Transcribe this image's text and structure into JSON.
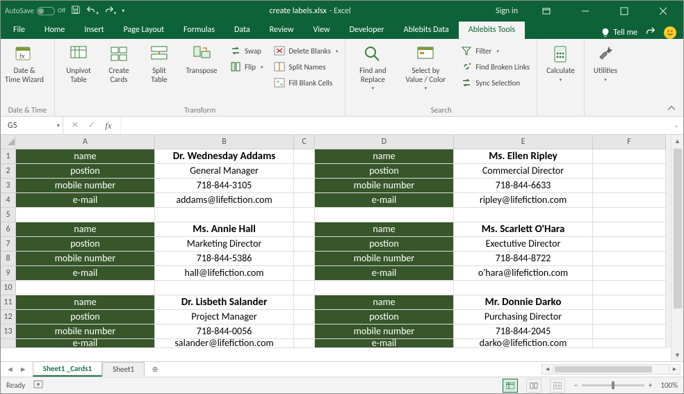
{
  "title": {
    "autosave": "AutoSave",
    "autosave_state": "Off",
    "filename": "create labels.xlsx",
    "app": " - Excel",
    "signin": "Sign in"
  },
  "file_tab": "File",
  "tabs": [
    "Home",
    "Insert",
    "Page Layout",
    "Formulas",
    "Data",
    "Review",
    "View",
    "Developer",
    "Ablebits Data",
    "Ablebits Tools"
  ],
  "active_tab": "Ablebits Tools",
  "tellme": "Tell me",
  "ribbon": {
    "groups": {
      "datetime": {
        "label": "Date & Time",
        "btn": "Date &\nTime Wizard"
      },
      "transform": {
        "label": "Transform",
        "big": [
          "Unpivot\nTable",
          "Create\nCards",
          "Split\nTable",
          "Transpose"
        ],
        "small": [
          "Swap",
          "Flip",
          "Delete Blanks",
          "Split Names",
          "Fill Blank Cells"
        ]
      },
      "search": {
        "label": "Search",
        "big": [
          "Find and\nReplace",
          "Select by\nValue / Color"
        ],
        "small": [
          "Filter",
          "Find Broken Links",
          "Sync Selection"
        ]
      },
      "calc": {
        "btn": "Calculate"
      },
      "util": {
        "btn": "Utilities"
      }
    }
  },
  "namebox": "G5",
  "formula": "",
  "columns": [
    "A",
    "B",
    "C",
    "D",
    "E",
    "F"
  ],
  "rows": [
    "1",
    "2",
    "3",
    "4",
    "5",
    "6",
    "7",
    "8",
    "9",
    "10",
    "11",
    "12",
    "13"
  ],
  "fields": [
    "name",
    "postion",
    "mobile number",
    "e-mail"
  ],
  "cards": [
    [
      {
        "name": "Dr. Wednesday Addams",
        "postion": "General Manager",
        "mobile": "718-844-3105",
        "email": "addams@lifefiction.com"
      },
      {
        "name": "Ms. Ellen Ripley",
        "postion": "Commercial Director",
        "mobile": "718-844-6633",
        "email": "ripley@lifefiction.com"
      }
    ],
    [
      {
        "name": "Ms. Annie Hall",
        "postion": "Marketing Director",
        "mobile": "718-844-5386",
        "email": "hall@lifefiction.com"
      },
      {
        "name": "Ms. Scarlett O'Hara",
        "postion": "Exectutive Director",
        "mobile": "718-844-8722",
        "email": "o'hara@lifefiction.com"
      }
    ],
    [
      {
        "name": "Dr. Lisbeth Salander",
        "postion": "Project Manager",
        "mobile": "718-844-0056",
        "email": "salander@lifefiction.com"
      },
      {
        "name": "Mr. Donnie Darko",
        "postion": "Purchasing Director",
        "mobile": "718-844-2045",
        "email": "darko@lifefiction.com"
      }
    ]
  ],
  "sheets": {
    "active": "Sheet1 _Cards1",
    "others": [
      "Sheet1"
    ]
  },
  "status": {
    "ready": "Ready",
    "zoom": "100%"
  }
}
